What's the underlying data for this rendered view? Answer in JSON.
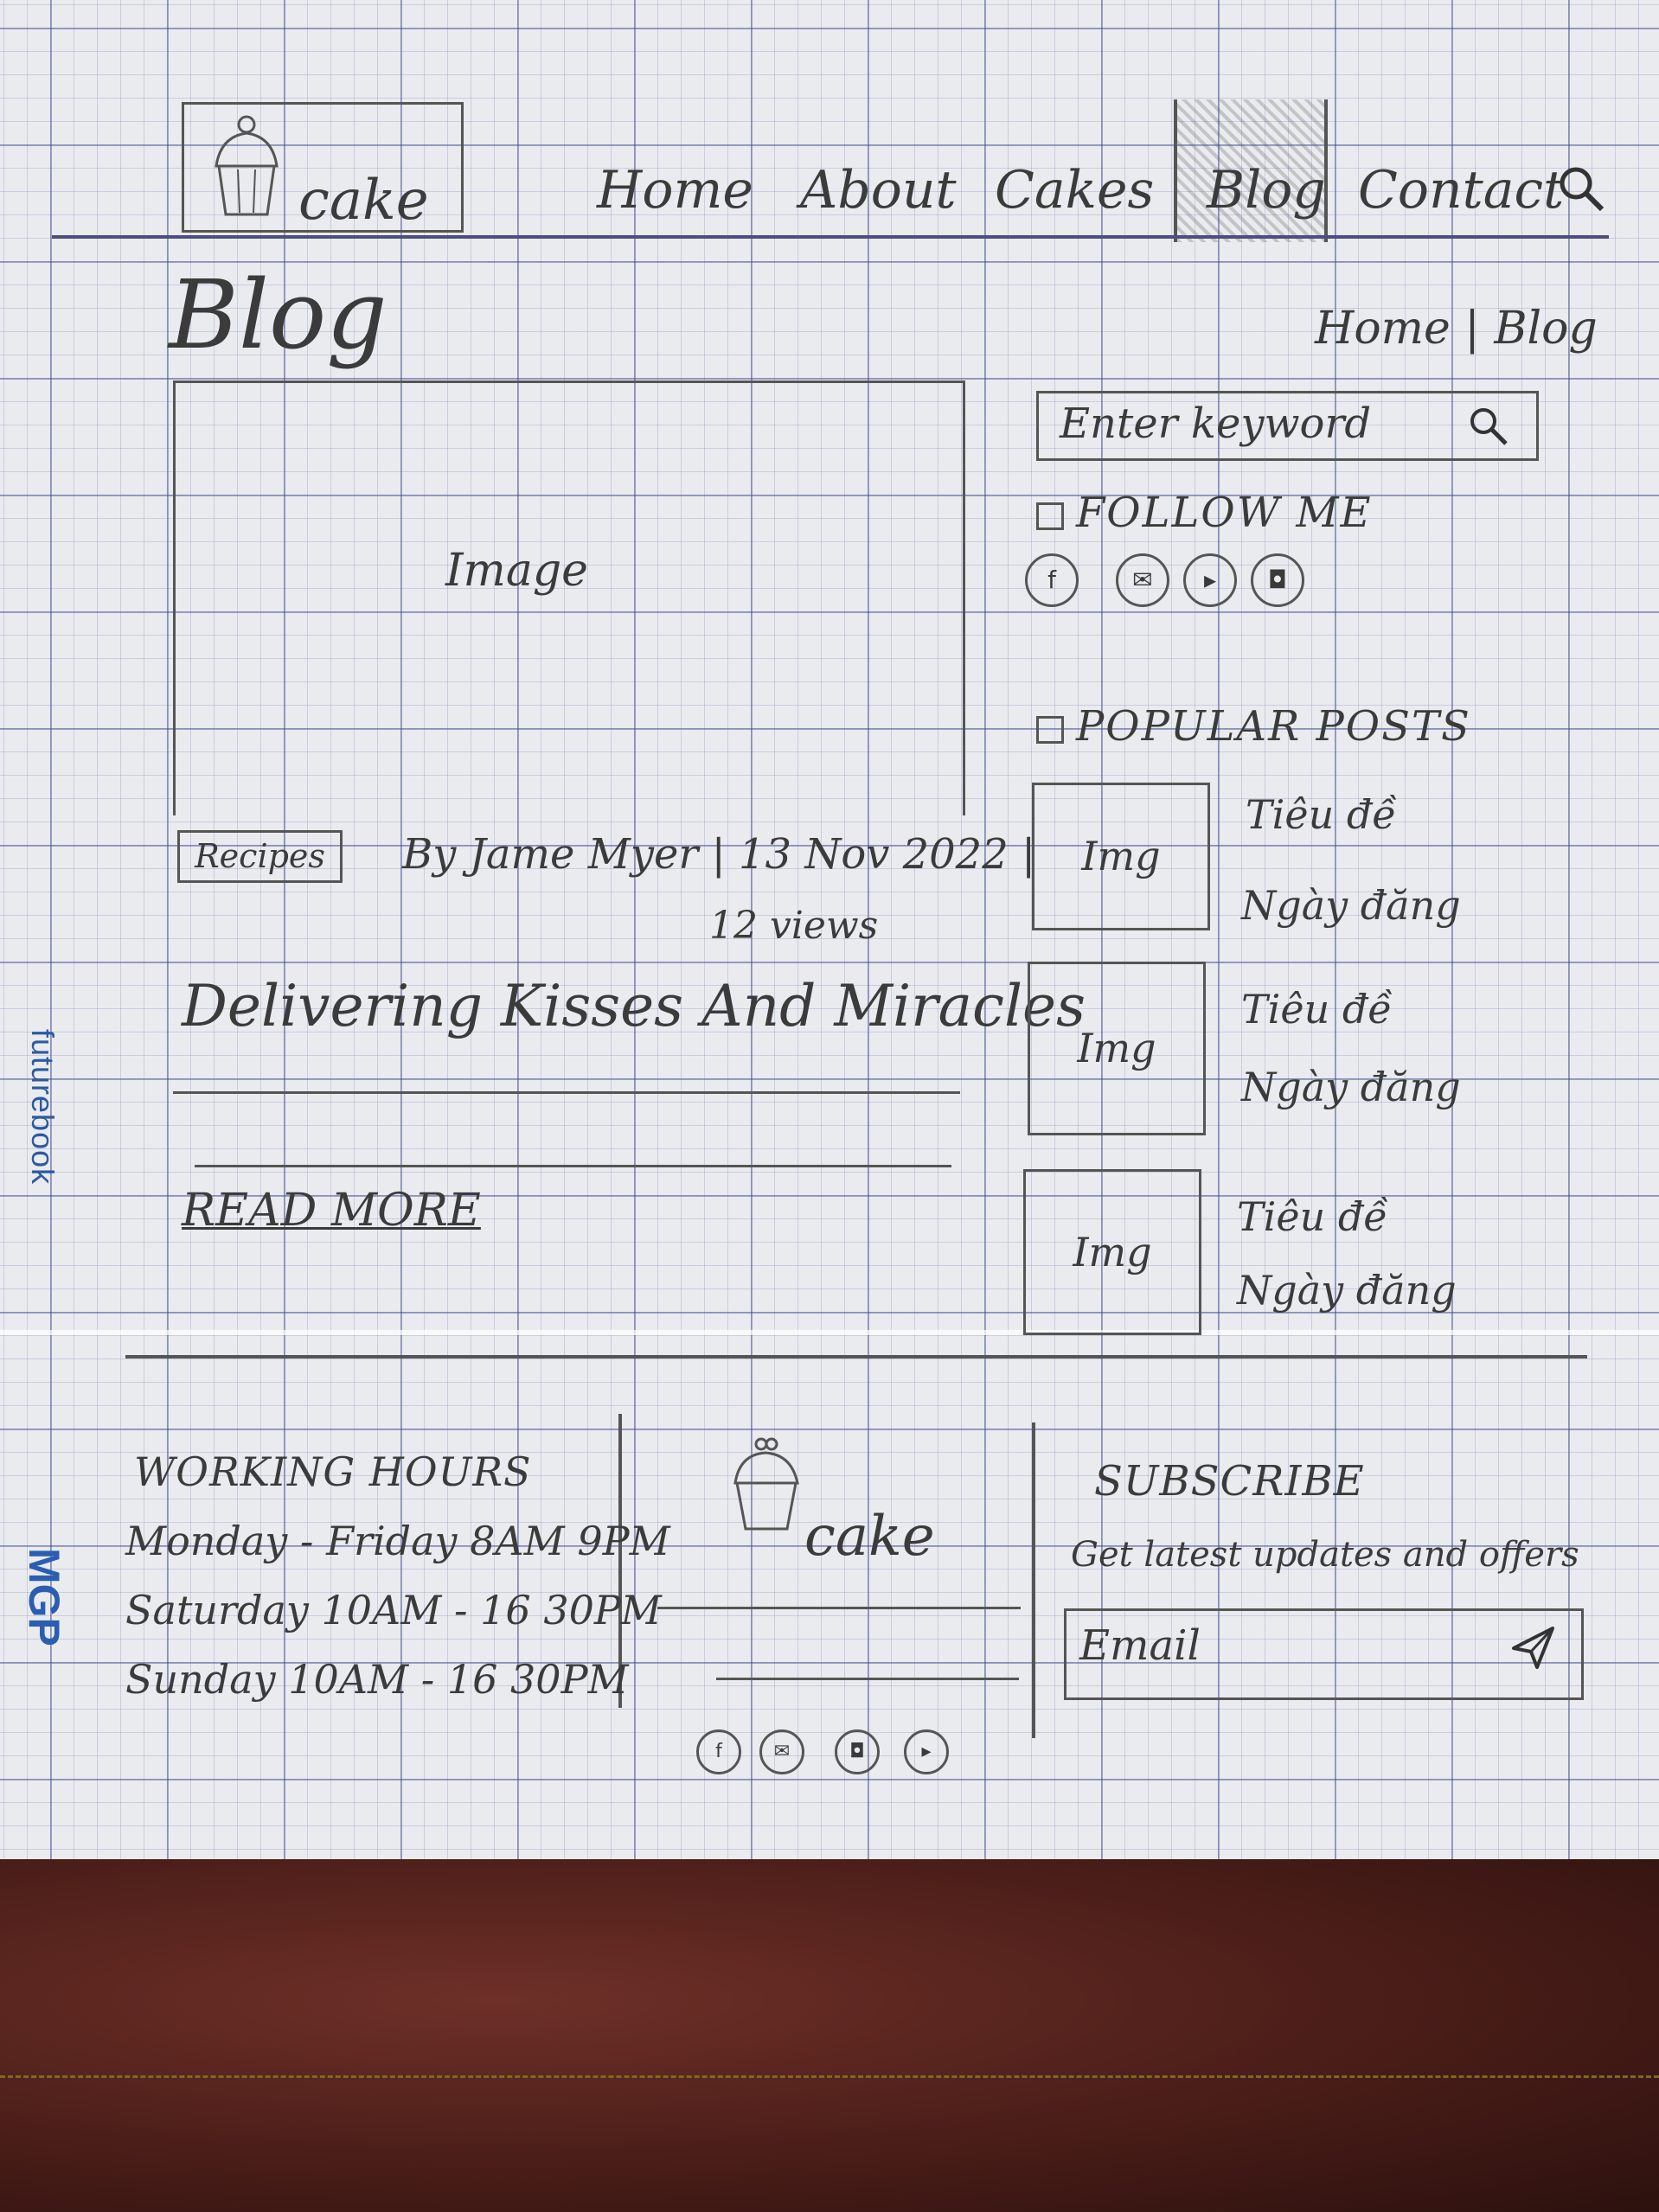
{
  "header": {
    "logo_text": "cake",
    "nav": [
      "Home",
      "About",
      "Cakes",
      "Blog",
      "Contact"
    ]
  },
  "page": {
    "title": "Blog",
    "breadcrumb": "Home | Blog"
  },
  "post": {
    "image_label": "Image",
    "category": "Recipes",
    "meta": "By Jame Myer | 13 Nov 2022 |",
    "views": "12 views",
    "title": "Delivering Kisses And Miracles",
    "read_more": "READ MORE"
  },
  "sidebar": {
    "search_placeholder": "Enter keyword",
    "follow_title": "FOLLOW ME",
    "social_icons": [
      "facebook-icon",
      "twitter-icon",
      "youtube-icon",
      "instagram-icon"
    ],
    "popular_title": "POPULAR POSTS",
    "popular_posts": [
      {
        "thumb": "Img",
        "title": "Tiêu đề",
        "date": "Ngày đăng"
      },
      {
        "thumb": "Img",
        "title": "Tiêu đề",
        "date": "Ngày đăng"
      },
      {
        "thumb": "Img",
        "title": "Tiêu đề",
        "date": "Ngày đăng"
      }
    ]
  },
  "footer": {
    "hours_title": "WORKING HOURS",
    "hours": [
      "Monday - Friday 8AM 9PM",
      "Saturday 10AM - 16 30PM",
      "Sunday 10AM - 16 30PM"
    ],
    "logo_text": "cake",
    "social_icons": [
      "facebook-icon",
      "twitter-icon",
      "instagram-icon",
      "youtube-icon"
    ],
    "subscribe_title": "SUBSCRIBE",
    "subscribe_desc": "Get latest updates and offers",
    "email_placeholder": "Email"
  },
  "branding": {
    "notebook": "futurebook",
    "maker": "MGP"
  }
}
